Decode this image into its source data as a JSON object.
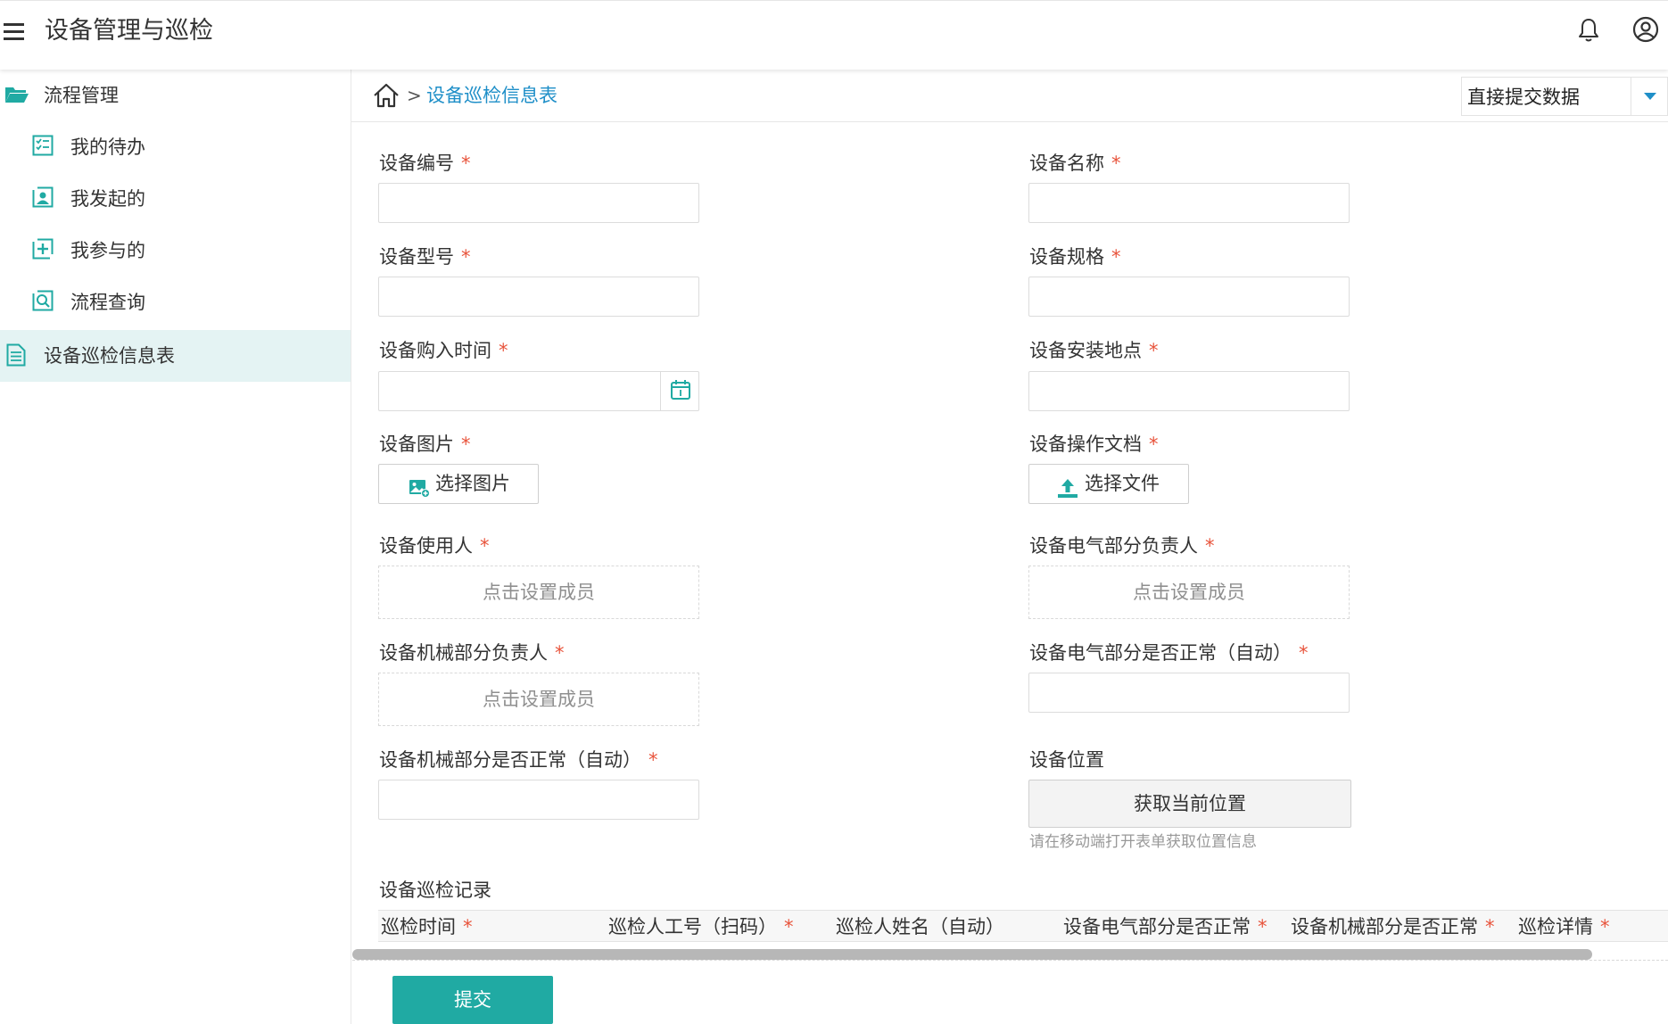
{
  "app": {
    "title": "设备管理与巡检",
    "menu_icon": "hamburger-menu-icon",
    "notification_icon": "bell-icon",
    "user_icon": "user-circle-icon"
  },
  "sidebar": {
    "items": [
      {
        "label": "流程管理",
        "icon": "folder-open-icon"
      },
      {
        "label": "我的待办",
        "icon": "checklist-icon"
      },
      {
        "label": "我发起的",
        "icon": "user-card-icon"
      },
      {
        "label": "我参与的",
        "icon": "plus-square-icon"
      },
      {
        "label": "流程查询",
        "icon": "search-document-icon"
      },
      {
        "label": "设备巡检信息表",
        "icon": "document-icon",
        "active": true
      }
    ]
  },
  "breadcrumb": {
    "home_icon": "home-icon",
    "separator": ">",
    "current": "设备巡检信息表"
  },
  "submit_mode": {
    "selected": "直接提交数据"
  },
  "form": {
    "required_mark": "*",
    "device_no": {
      "label": "设备编号",
      "value": ""
    },
    "device_name": {
      "label": "设备名称",
      "value": ""
    },
    "device_model": {
      "label": "设备型号",
      "value": ""
    },
    "device_spec": {
      "label": "设备规格",
      "value": ""
    },
    "purchase_date": {
      "label": "设备购入时间",
      "value": "",
      "icon": "calendar-icon"
    },
    "install_location": {
      "label": "设备安装地点",
      "value": ""
    },
    "device_image": {
      "label": "设备图片",
      "button": "选择图片",
      "icon": "image-upload-icon"
    },
    "operation_doc": {
      "label": "设备操作文档",
      "button": "选择文件",
      "icon": "upload-icon"
    },
    "device_user": {
      "label": "设备使用人",
      "placeholder": "点击设置成员"
    },
    "electrical_owner": {
      "label": "设备电气部分负责人",
      "placeholder": "点击设置成员"
    },
    "mechanical_owner": {
      "label": "设备机械部分负责人",
      "placeholder": "点击设置成员"
    },
    "electrical_normal": {
      "label": "设备电气部分是否正常（自动）",
      "value": ""
    },
    "mechanical_normal": {
      "label": "设备机械部分是否正常（自动）",
      "value": ""
    },
    "device_position": {
      "label": "设备位置",
      "button": "获取当前位置",
      "hint": "请在移动端打开表单获取位置信息"
    }
  },
  "inspection_table": {
    "title": "设备巡检记录",
    "columns": [
      {
        "label": "巡检时间",
        "required": true
      },
      {
        "label": "巡检人工号（扫码）",
        "required": true
      },
      {
        "label": "巡检人姓名（自动）",
        "required": false
      },
      {
        "label": "设备电气部分是否正常",
        "required": true
      },
      {
        "label": "设备机械部分是否正常",
        "required": true
      },
      {
        "label": "巡检详情",
        "required": true
      }
    ]
  },
  "actions": {
    "submit_label": "提交"
  },
  "colors": {
    "accent": "#20aaa3",
    "link": "#1f8fc8",
    "required": "#e8533b",
    "sidebar_active_bg": "#e4f3f3"
  }
}
